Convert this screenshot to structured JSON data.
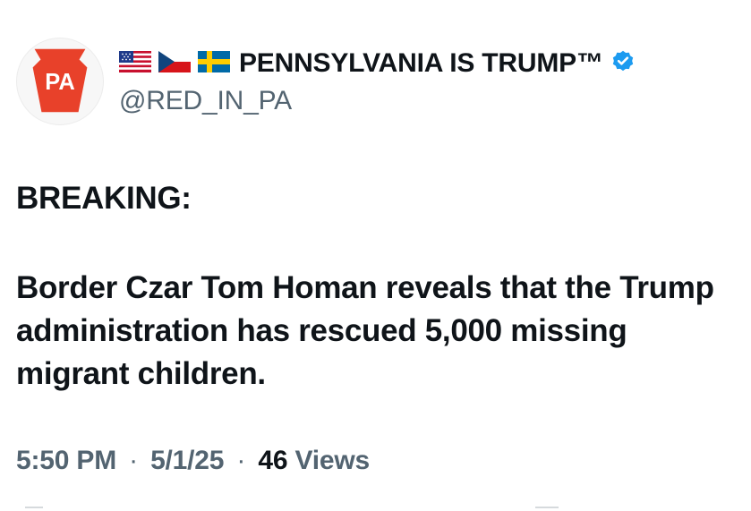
{
  "avatar": {
    "label": "PA",
    "keystone_color": "#e8412a"
  },
  "account": {
    "flags": [
      "us-flag",
      "czech-flag",
      "sweden-flag"
    ],
    "display_name": "PENNSYLVANIA IS TRUMP™",
    "handle": "@RED_IN_PA",
    "verified": true,
    "verified_color": "#1d9bf0"
  },
  "tweet": {
    "breaking": "BREAKING:",
    "headline": "Border Czar Tom Homan reveals that the Trump administration has rescued 5,000 missing migrant children."
  },
  "meta": {
    "time": "5:50 PM",
    "separator": "·",
    "date": "5/1/25",
    "views_count": "46",
    "views_label": "Views"
  }
}
